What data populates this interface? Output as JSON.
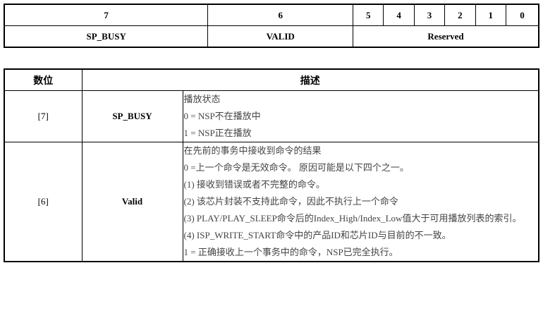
{
  "bit_table": {
    "bits": [
      "7",
      "6",
      "5",
      "4",
      "3",
      "2",
      "1",
      "0"
    ],
    "fields": {
      "b7": "SP_BUSY",
      "b6": "VALID",
      "reserved": "Reserved"
    }
  },
  "desc_table": {
    "headers": {
      "bit": "数位",
      "desc": "描述"
    },
    "rows": [
      {
        "bit": "[7]",
        "name": "SP_BUSY",
        "lines": [
          "播放状态",
          "0 = NSP不在播放中",
          "1 = NSP正在播放"
        ]
      },
      {
        "bit": "[6]",
        "name": "Valid",
        "lines": [
          "在先前的事务中接收到命令的结果",
          "0 =上一个命令是无效命令。 原因可能是以下四个之一。",
          " (1) 接收到错误或者不完整的命令。",
          " (2) 该芯片封装不支持此命令，因此不执行上一个命令",
          " (3) PLAY/PLAY_SLEEP命令后的Index_High/Index_Low值大于可用播放列表的索引。",
          "(4) ISP_WRITE_START命令中的产品ID和芯片ID与目前的不一致。",
          "1 = 正确接收上一个事务中的命令，NSP已完全执行。"
        ]
      }
    ]
  }
}
